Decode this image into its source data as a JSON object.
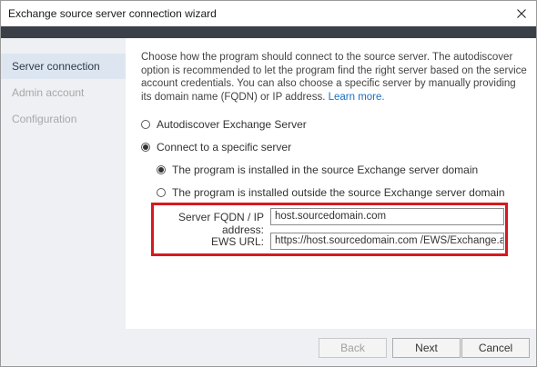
{
  "window": {
    "title": "Exchange source server connection wizard"
  },
  "sidebar": {
    "items": [
      {
        "label": "Server connection",
        "active": true
      },
      {
        "label": "Admin account",
        "active": false
      },
      {
        "label": "Configuration",
        "active": false
      }
    ]
  },
  "main": {
    "intro_text": "Choose how the program should connect to the source server. The autodiscover option is recommended to let the program find the right server based on the service account credentials. You can also choose a specific server by manually providing its domain name (FQDN) or IP address.",
    "learn_more": "Learn more.",
    "options": {
      "autodiscover": {
        "label": "Autodiscover Exchange Server",
        "selected": false
      },
      "specific": {
        "label": "Connect to a specific server",
        "selected": true
      },
      "inside_domain": {
        "label": "The program is installed in the source Exchange server domain",
        "selected": true
      },
      "outside_domain": {
        "label": "The program is installed outside the source Exchange server domain",
        "selected": false
      }
    },
    "fields": {
      "fqdn_label": "Server FQDN / IP address:",
      "fqdn_value": "host.sourcedomain.com",
      "ews_label": "EWS URL:",
      "ews_value": "https://host.sourcedomain.com /EWS/Exchange.asmx"
    }
  },
  "footer": {
    "back_label": "Back",
    "next_label": "Next",
    "cancel_label": "Cancel"
  },
  "colors": {
    "highlight": "#d7191f",
    "title_band": "#3b4048",
    "sidebar_bg": "#eef0f3",
    "active_item_bg": "#dde6f0",
    "link": "#1a6fc4"
  }
}
